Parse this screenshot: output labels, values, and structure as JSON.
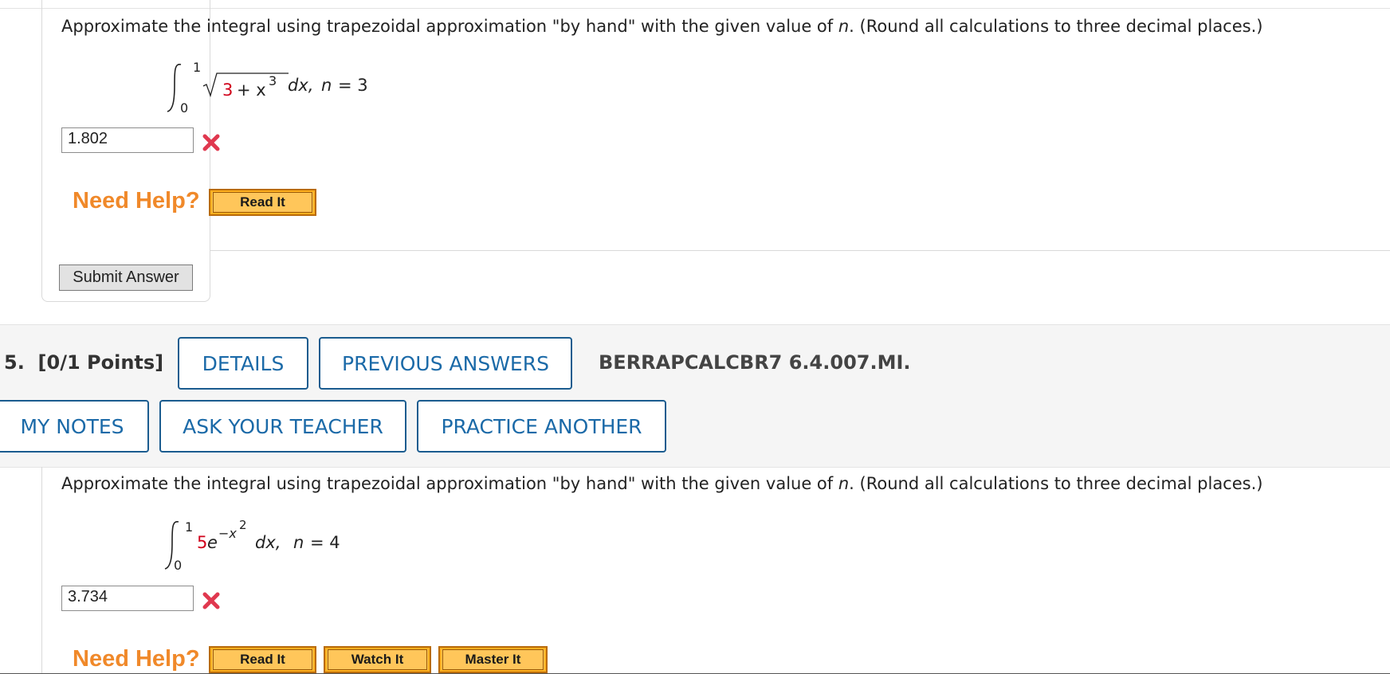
{
  "q4": {
    "prompt": "Approximate the integral using trapezoidal approximation \"by hand\" with the given value of n. (Round all calculations to three decimal places.)",
    "prompt_pre": "Approximate the integral using trapezoidal approximation \"by hand\" with the given value of ",
    "prompt_var": "n",
    "prompt_post": ". (Round all calculations to three decimal places.)",
    "integral": {
      "upper": "1",
      "lower": "0",
      "radicand_const": "3",
      "radicand_rest": "+ x",
      "exponent": "3",
      "tail_dx": "dx,",
      "tail_n": "n",
      "tail_eq": "= 3"
    },
    "answer_value": "1.802",
    "need_help": "Need Help?",
    "help_buttons": [
      "Read It"
    ],
    "submit_label": "Submit Answer"
  },
  "q5": {
    "header": {
      "number": "5.",
      "points": "[0/1 Points]",
      "details": "DETAILS",
      "previous_answers": "PREVIOUS ANSWERS",
      "code": "BERRAPCALCBR7 6.4.007.MI.",
      "my_notes": "MY NOTES",
      "ask_teacher": "ASK YOUR TEACHER",
      "practice_another": "PRACTICE ANOTHER"
    },
    "prompt_pre": "Approximate the integral using trapezoidal approximation \"by hand\" with the given value of ",
    "prompt_var": "n",
    "prompt_post": ". (Round all calculations to three decimal places.)",
    "integral": {
      "upper": "1",
      "lower": "0",
      "coef": "5",
      "base": "e",
      "exponent": "−x",
      "exponent_power": "2",
      "tail_dx": "dx,",
      "tail_n": "n",
      "tail_eq": "= 4"
    },
    "answer_value": "3.734",
    "need_help": "Need Help?",
    "help_buttons": [
      "Read It",
      "Watch It",
      "Master It"
    ]
  },
  "colors": {
    "accent_blue": "#1b6aa8",
    "need_help_orange": "#f0892a",
    "help_button_fill": "#ffc65a",
    "error_red": "#d0021b",
    "band_gray": "#f5f5f5"
  },
  "icons": [
    "x-mark-icon",
    "integral-sign-icon",
    "radical-sign-icon"
  ]
}
